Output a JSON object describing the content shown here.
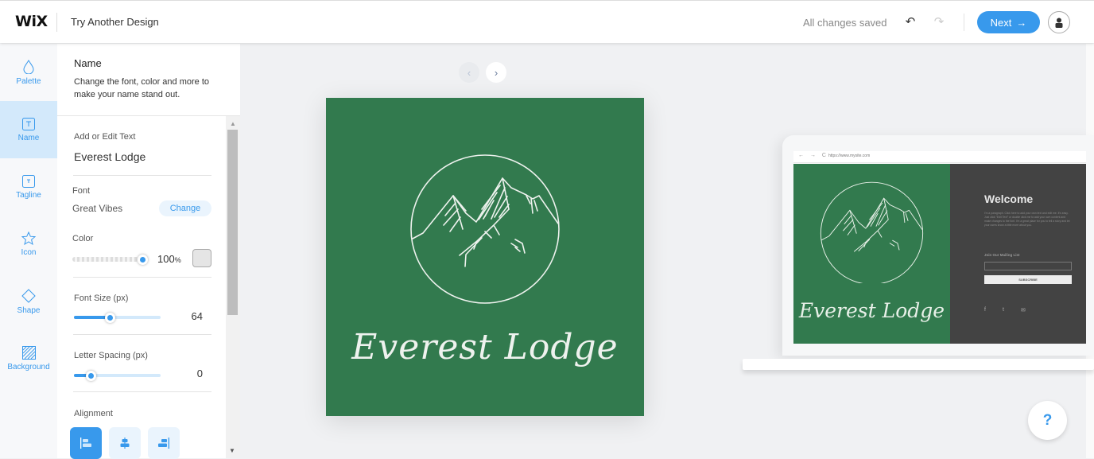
{
  "topbar": {
    "logo": "WiX",
    "title": "Try Another Design",
    "status": "All changes saved",
    "next_label": "Next",
    "next_arrow": "→",
    "undo_icon": "↶",
    "redo_icon": "↷"
  },
  "sidebar": {
    "items": [
      {
        "label": "Palette",
        "icon": "droplet-icon",
        "active": false
      },
      {
        "label": "Name",
        "icon": "text-box-icon",
        "active": true
      },
      {
        "label": "Tagline",
        "icon": "text-box-small-icon",
        "active": false
      },
      {
        "label": "Icon",
        "icon": "star-icon",
        "active": false
      },
      {
        "label": "Shape",
        "icon": "diamond-icon",
        "active": false
      },
      {
        "label": "Background",
        "icon": "hatched-square-icon",
        "active": false
      }
    ]
  },
  "panel": {
    "title": "Name",
    "description": "Change the font, color and more to make your name stand out.",
    "text_label": "Add or Edit Text",
    "text_value": "Everest Lodge",
    "font_label": "Font",
    "font_value": "Great Vibes",
    "change_label": "Change",
    "color_label": "Color",
    "opacity_value": "100",
    "opacity_unit": "%",
    "opacity_fraction": 1.0,
    "color_swatch": "#e5e5e5",
    "font_size_label": "Font Size (px)",
    "font_size_value": "64",
    "font_size_fraction": 0.42,
    "letter_spacing_label": "Letter Spacing (px)",
    "letter_spacing_value": "0",
    "letter_spacing_fraction": 0.2,
    "alignment_label": "Alignment",
    "alignment_options": [
      "left",
      "center",
      "right"
    ],
    "alignment_selected": "left"
  },
  "stage": {
    "prev_icon": "‹",
    "next_icon": "›",
    "logo_name": "Everest Lodge",
    "logo_bg": "#327a4e",
    "preview": {
      "nav": "← → C",
      "url": "https://www.mysite.com",
      "welcome": "Welcome",
      "paragraph": "I'm a paragraph. Click here to add your own text and edit me. It's easy. Just click \"Edit Text\" or double click me to add your own content and make changes to the font. I'm a great place for you to tell a story and let your users know a little more about you.",
      "mailing": "Join Our Mailing List",
      "subscribe": "SUBSCRIBE",
      "social": [
        "f",
        "t",
        "✉"
      ]
    },
    "help_label": "?"
  },
  "colors": {
    "accent": "#3899ec",
    "logo_green": "#327a4e",
    "preview_dark": "#434343"
  }
}
